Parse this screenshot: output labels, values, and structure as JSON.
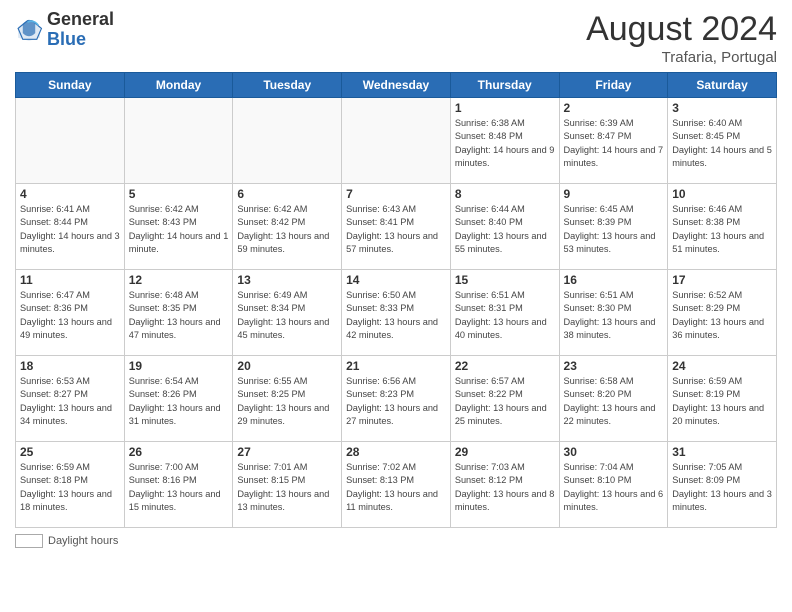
{
  "header": {
    "logo_general": "General",
    "logo_blue": "Blue",
    "month_title": "August 2024",
    "subtitle": "Trafaria, Portugal"
  },
  "weekdays": [
    "Sunday",
    "Monday",
    "Tuesday",
    "Wednesday",
    "Thursday",
    "Friday",
    "Saturday"
  ],
  "weeks": [
    [
      {
        "day": "",
        "info": ""
      },
      {
        "day": "",
        "info": ""
      },
      {
        "day": "",
        "info": ""
      },
      {
        "day": "",
        "info": ""
      },
      {
        "day": "1",
        "info": "Sunrise: 6:38 AM\nSunset: 8:48 PM\nDaylight: 14 hours and 9 minutes."
      },
      {
        "day": "2",
        "info": "Sunrise: 6:39 AM\nSunset: 8:47 PM\nDaylight: 14 hours and 7 minutes."
      },
      {
        "day": "3",
        "info": "Sunrise: 6:40 AM\nSunset: 8:45 PM\nDaylight: 14 hours and 5 minutes."
      }
    ],
    [
      {
        "day": "4",
        "info": "Sunrise: 6:41 AM\nSunset: 8:44 PM\nDaylight: 14 hours and 3 minutes."
      },
      {
        "day": "5",
        "info": "Sunrise: 6:42 AM\nSunset: 8:43 PM\nDaylight: 14 hours and 1 minute."
      },
      {
        "day": "6",
        "info": "Sunrise: 6:42 AM\nSunset: 8:42 PM\nDaylight: 13 hours and 59 minutes."
      },
      {
        "day": "7",
        "info": "Sunrise: 6:43 AM\nSunset: 8:41 PM\nDaylight: 13 hours and 57 minutes."
      },
      {
        "day": "8",
        "info": "Sunrise: 6:44 AM\nSunset: 8:40 PM\nDaylight: 13 hours and 55 minutes."
      },
      {
        "day": "9",
        "info": "Sunrise: 6:45 AM\nSunset: 8:39 PM\nDaylight: 13 hours and 53 minutes."
      },
      {
        "day": "10",
        "info": "Sunrise: 6:46 AM\nSunset: 8:38 PM\nDaylight: 13 hours and 51 minutes."
      }
    ],
    [
      {
        "day": "11",
        "info": "Sunrise: 6:47 AM\nSunset: 8:36 PM\nDaylight: 13 hours and 49 minutes."
      },
      {
        "day": "12",
        "info": "Sunrise: 6:48 AM\nSunset: 8:35 PM\nDaylight: 13 hours and 47 minutes."
      },
      {
        "day": "13",
        "info": "Sunrise: 6:49 AM\nSunset: 8:34 PM\nDaylight: 13 hours and 45 minutes."
      },
      {
        "day": "14",
        "info": "Sunrise: 6:50 AM\nSunset: 8:33 PM\nDaylight: 13 hours and 42 minutes."
      },
      {
        "day": "15",
        "info": "Sunrise: 6:51 AM\nSunset: 8:31 PM\nDaylight: 13 hours and 40 minutes."
      },
      {
        "day": "16",
        "info": "Sunrise: 6:51 AM\nSunset: 8:30 PM\nDaylight: 13 hours and 38 minutes."
      },
      {
        "day": "17",
        "info": "Sunrise: 6:52 AM\nSunset: 8:29 PM\nDaylight: 13 hours and 36 minutes."
      }
    ],
    [
      {
        "day": "18",
        "info": "Sunrise: 6:53 AM\nSunset: 8:27 PM\nDaylight: 13 hours and 34 minutes."
      },
      {
        "day": "19",
        "info": "Sunrise: 6:54 AM\nSunset: 8:26 PM\nDaylight: 13 hours and 31 minutes."
      },
      {
        "day": "20",
        "info": "Sunrise: 6:55 AM\nSunset: 8:25 PM\nDaylight: 13 hours and 29 minutes."
      },
      {
        "day": "21",
        "info": "Sunrise: 6:56 AM\nSunset: 8:23 PM\nDaylight: 13 hours and 27 minutes."
      },
      {
        "day": "22",
        "info": "Sunrise: 6:57 AM\nSunset: 8:22 PM\nDaylight: 13 hours and 25 minutes."
      },
      {
        "day": "23",
        "info": "Sunrise: 6:58 AM\nSunset: 8:20 PM\nDaylight: 13 hours and 22 minutes."
      },
      {
        "day": "24",
        "info": "Sunrise: 6:59 AM\nSunset: 8:19 PM\nDaylight: 13 hours and 20 minutes."
      }
    ],
    [
      {
        "day": "25",
        "info": "Sunrise: 6:59 AM\nSunset: 8:18 PM\nDaylight: 13 hours and 18 minutes."
      },
      {
        "day": "26",
        "info": "Sunrise: 7:00 AM\nSunset: 8:16 PM\nDaylight: 13 hours and 15 minutes."
      },
      {
        "day": "27",
        "info": "Sunrise: 7:01 AM\nSunset: 8:15 PM\nDaylight: 13 hours and 13 minutes."
      },
      {
        "day": "28",
        "info": "Sunrise: 7:02 AM\nSunset: 8:13 PM\nDaylight: 13 hours and 11 minutes."
      },
      {
        "day": "29",
        "info": "Sunrise: 7:03 AM\nSunset: 8:12 PM\nDaylight: 13 hours and 8 minutes."
      },
      {
        "day": "30",
        "info": "Sunrise: 7:04 AM\nSunset: 8:10 PM\nDaylight: 13 hours and 6 minutes."
      },
      {
        "day": "31",
        "info": "Sunrise: 7:05 AM\nSunset: 8:09 PM\nDaylight: 13 hours and 3 minutes."
      }
    ]
  ],
  "footer": {
    "legend_label": "Daylight hours"
  }
}
